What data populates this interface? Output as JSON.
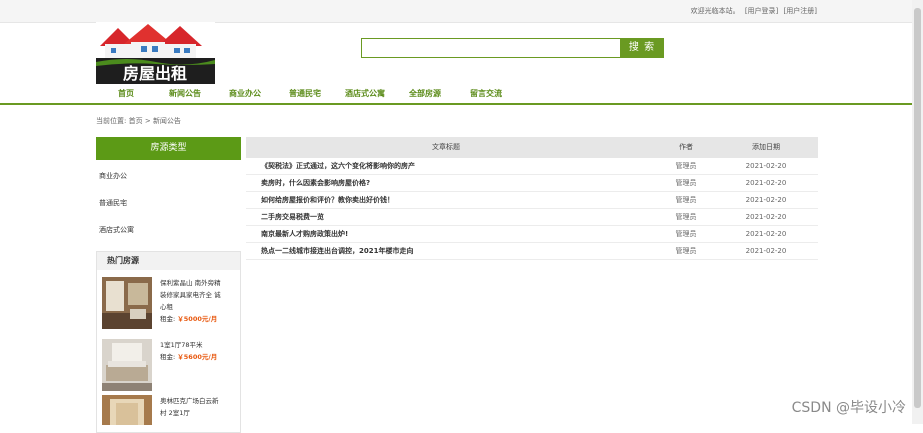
{
  "topbar": {
    "welcome": "欢迎光临本站。",
    "login": "[用户登录]",
    "register": "[用户注册]"
  },
  "logo": {
    "text": "房屋出租"
  },
  "search": {
    "value": "",
    "button": "搜 索"
  },
  "nav": [
    "首页",
    "新闻公告",
    "商业办公",
    "普通民宅",
    "酒店式公寓",
    "全部房源",
    "留言交流"
  ],
  "breadcrumb": {
    "prefix": "当前位置:",
    "home": "首页",
    "sep": ">",
    "current": "新闻公告"
  },
  "sidebar": {
    "title": "房源类型",
    "items": [
      "商业办公",
      "普通民宅",
      "酒店式公寓"
    ]
  },
  "hot": {
    "title": "热门房源",
    "items": [
      {
        "title": "保利紫晶山 南外旁精装修家具家电齐全 诚心租",
        "price_label": "租金:",
        "price": "￥5000元/月"
      },
      {
        "title": "1室1厅78平米",
        "price_label": "租金:",
        "price": "￥5600元/月"
      },
      {
        "title": "奥林匹克广场白云新村 2室1厅",
        "price_label": "",
        "price": ""
      }
    ]
  },
  "table": {
    "headers": [
      "文章标题",
      "作者",
      "添加日期"
    ],
    "rows": [
      {
        "title": "《契税法》正式通过，这六个变化将影响你的房产",
        "author": "管理员",
        "date": "2021-02-20"
      },
      {
        "title": "卖房时，什么因素会影响房屋价格?",
        "author": "管理员",
        "date": "2021-02-20"
      },
      {
        "title": "如何给房屋报价和评价？教你卖出好价钱！",
        "author": "管理员",
        "date": "2021-02-20"
      },
      {
        "title": "二手房交易税费一览",
        "author": "管理员",
        "date": "2021-02-20"
      },
      {
        "title": "南京最新人才购房政策出炉!",
        "author": "管理员",
        "date": "2021-02-20"
      },
      {
        "title": "热点一二线城市接连出台调控，2021年楼市走向",
        "author": "管理员",
        "date": "2021-02-20"
      }
    ]
  },
  "watermark": "CSDN @毕设小冷"
}
